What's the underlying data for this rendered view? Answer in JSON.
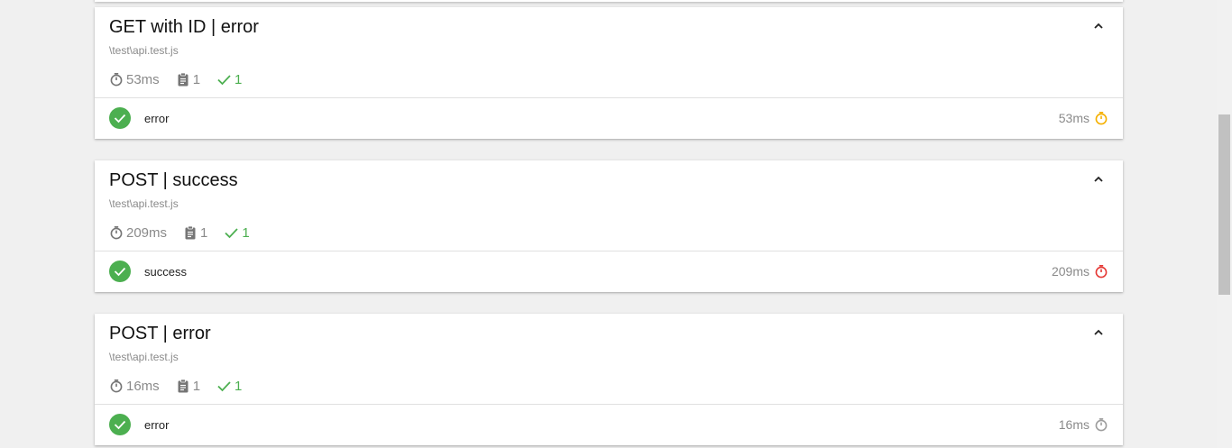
{
  "colors": {
    "pass": "#4caf50",
    "speed_medium": "#f5b000",
    "speed_slow": "#e53935",
    "speed_fast": "#9e9e9e",
    "text_muted": "#8a8a8a"
  },
  "suites": [
    {
      "title": "GET with ID | error",
      "file": "\\test\\api.test.js",
      "duration": "53ms",
      "tests_count": "1",
      "passed_count": "1",
      "collapse_icon": "chevron-up-icon",
      "tests": [
        {
          "name": "error",
          "status": "passed",
          "duration": "53ms",
          "speed": "medium"
        }
      ]
    },
    {
      "title": "POST | success",
      "file": "\\test\\api.test.js",
      "duration": "209ms",
      "tests_count": "1",
      "passed_count": "1",
      "collapse_icon": "chevron-up-icon",
      "tests": [
        {
          "name": "success",
          "status": "passed",
          "duration": "209ms",
          "speed": "slow"
        }
      ]
    },
    {
      "title": "POST | error",
      "file": "\\test\\api.test.js",
      "duration": "16ms",
      "tests_count": "1",
      "passed_count": "1",
      "collapse_icon": "chevron-up-icon",
      "tests": [
        {
          "name": "error",
          "status": "passed",
          "duration": "16ms",
          "speed": "fast"
        }
      ]
    }
  ]
}
